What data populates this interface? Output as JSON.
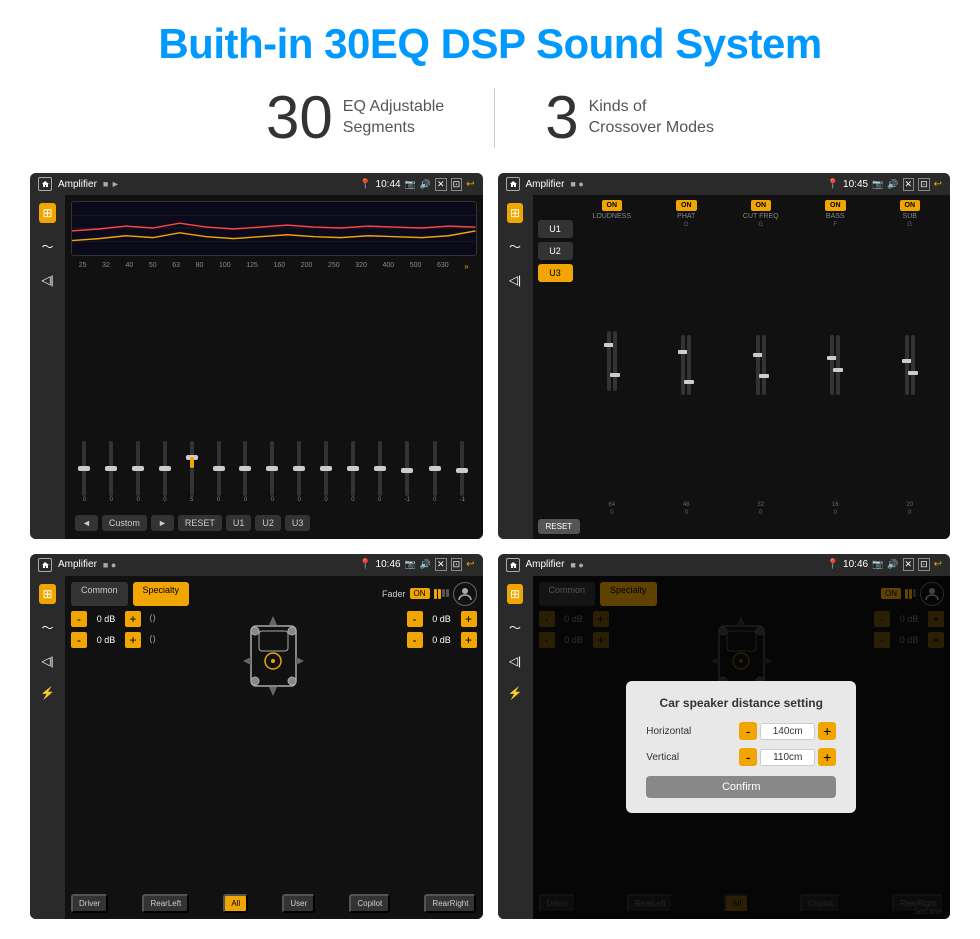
{
  "title": "Buith-in 30EQ DSP Sound System",
  "stats": [
    {
      "number": "30",
      "text_line1": "EQ Adjustable",
      "text_line2": "Segments"
    },
    {
      "number": "3",
      "text_line1": "Kinds of",
      "text_line2": "Crossover Modes"
    }
  ],
  "screens": {
    "eq1": {
      "status_time": "10:44",
      "title": "Amplifier",
      "freq_labels": [
        "25",
        "32",
        "40",
        "50",
        "63",
        "80",
        "100",
        "125",
        "160",
        "200",
        "250",
        "320",
        "400",
        "500",
        "630"
      ],
      "slider_values": [
        "0",
        "0",
        "0",
        "0",
        "5",
        "0",
        "0",
        "0",
        "0",
        "0",
        "0",
        "0",
        "-1",
        "0",
        "-1"
      ],
      "bottom_btns": [
        "◄",
        "Custom",
        "►",
        "RESET",
        "U1",
        "U2",
        "U3"
      ]
    },
    "eq2": {
      "status_time": "10:45",
      "title": "Amplifier",
      "presets": [
        "U1",
        "U2",
        "U3"
      ],
      "active_preset": "U3",
      "bands": [
        {
          "name": "LOUDNESS",
          "on": true,
          "sub_label": ""
        },
        {
          "name": "PHAT",
          "on": true,
          "sub_label": "G"
        },
        {
          "name": "CUT FREQ",
          "on": true,
          "sub_label": "G"
        },
        {
          "name": "BASS",
          "on": true,
          "sub_label": "F"
        },
        {
          "name": "SUB",
          "on": true,
          "sub_label": "G"
        }
      ],
      "reset_label": "RESET"
    },
    "specialty1": {
      "status_time": "10:46",
      "title": "Amplifier",
      "tabs": [
        "Common",
        "Specialty"
      ],
      "active_tab": "Specialty",
      "fader_label": "Fader",
      "fader_on": "ON",
      "db_values": [
        "0 dB",
        "0 dB",
        "0 dB",
        "0 dB"
      ],
      "speaker_btns": [
        "Driver",
        "RearLeft",
        "All",
        "User",
        "Copilot",
        "RearRight"
      ]
    },
    "specialty2": {
      "status_time": "10:46",
      "title": "Amplifier",
      "tabs": [
        "Common",
        "Specialty"
      ],
      "active_tab": "Specialty",
      "modal": {
        "title": "Car speaker distance setting",
        "horizontal_label": "Horizontal",
        "horizontal_value": "140cm",
        "vertical_label": "Vertical",
        "vertical_value": "110cm",
        "confirm_label": "Confirm"
      },
      "db_values": [
        "0 dB",
        "0 dB"
      ],
      "speaker_btns": [
        "Driver",
        "RearLeft",
        "All",
        "Copilot",
        "RearRight"
      ]
    }
  },
  "watermark": "Seicane"
}
